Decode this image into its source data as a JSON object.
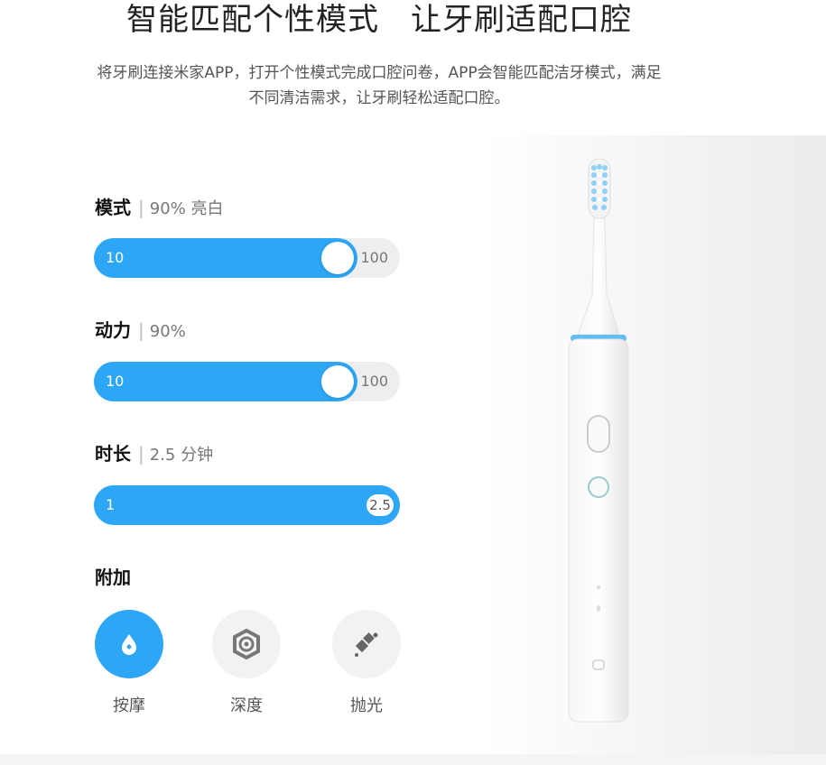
{
  "headline": "智能匹配个性模式　让牙刷适配口腔",
  "subcopy": {
    "line1": "将牙刷连接米家APP，打开个性模式完成口腔问卷，APP会智能匹配洁牙模式，满足",
    "line2": "不同清洁需求，让牙刷轻松适配口腔。"
  },
  "controls": [
    {
      "label": "模式",
      "value": "90% 亮白",
      "min": "10",
      "max": "100",
      "level": 0.9
    },
    {
      "label": "动力",
      "value": "90%",
      "min": "10",
      "max": "100",
      "level": 0.9
    },
    {
      "label": "时长",
      "value": "2.5 分钟",
      "min": "1",
      "max": "2.5",
      "level": 1.0
    }
  ],
  "extras": {
    "title": "附加",
    "items": [
      {
        "label": "按摩",
        "icon": "massage-drop-icon",
        "active": true
      },
      {
        "label": "深度",
        "icon": "deep-clean-icon",
        "active": false
      },
      {
        "label": "抛光",
        "icon": "polish-icon",
        "active": false
      }
    ]
  },
  "colors": {
    "accent": "#2ca6f5",
    "inactive": "#f2f2f2"
  }
}
